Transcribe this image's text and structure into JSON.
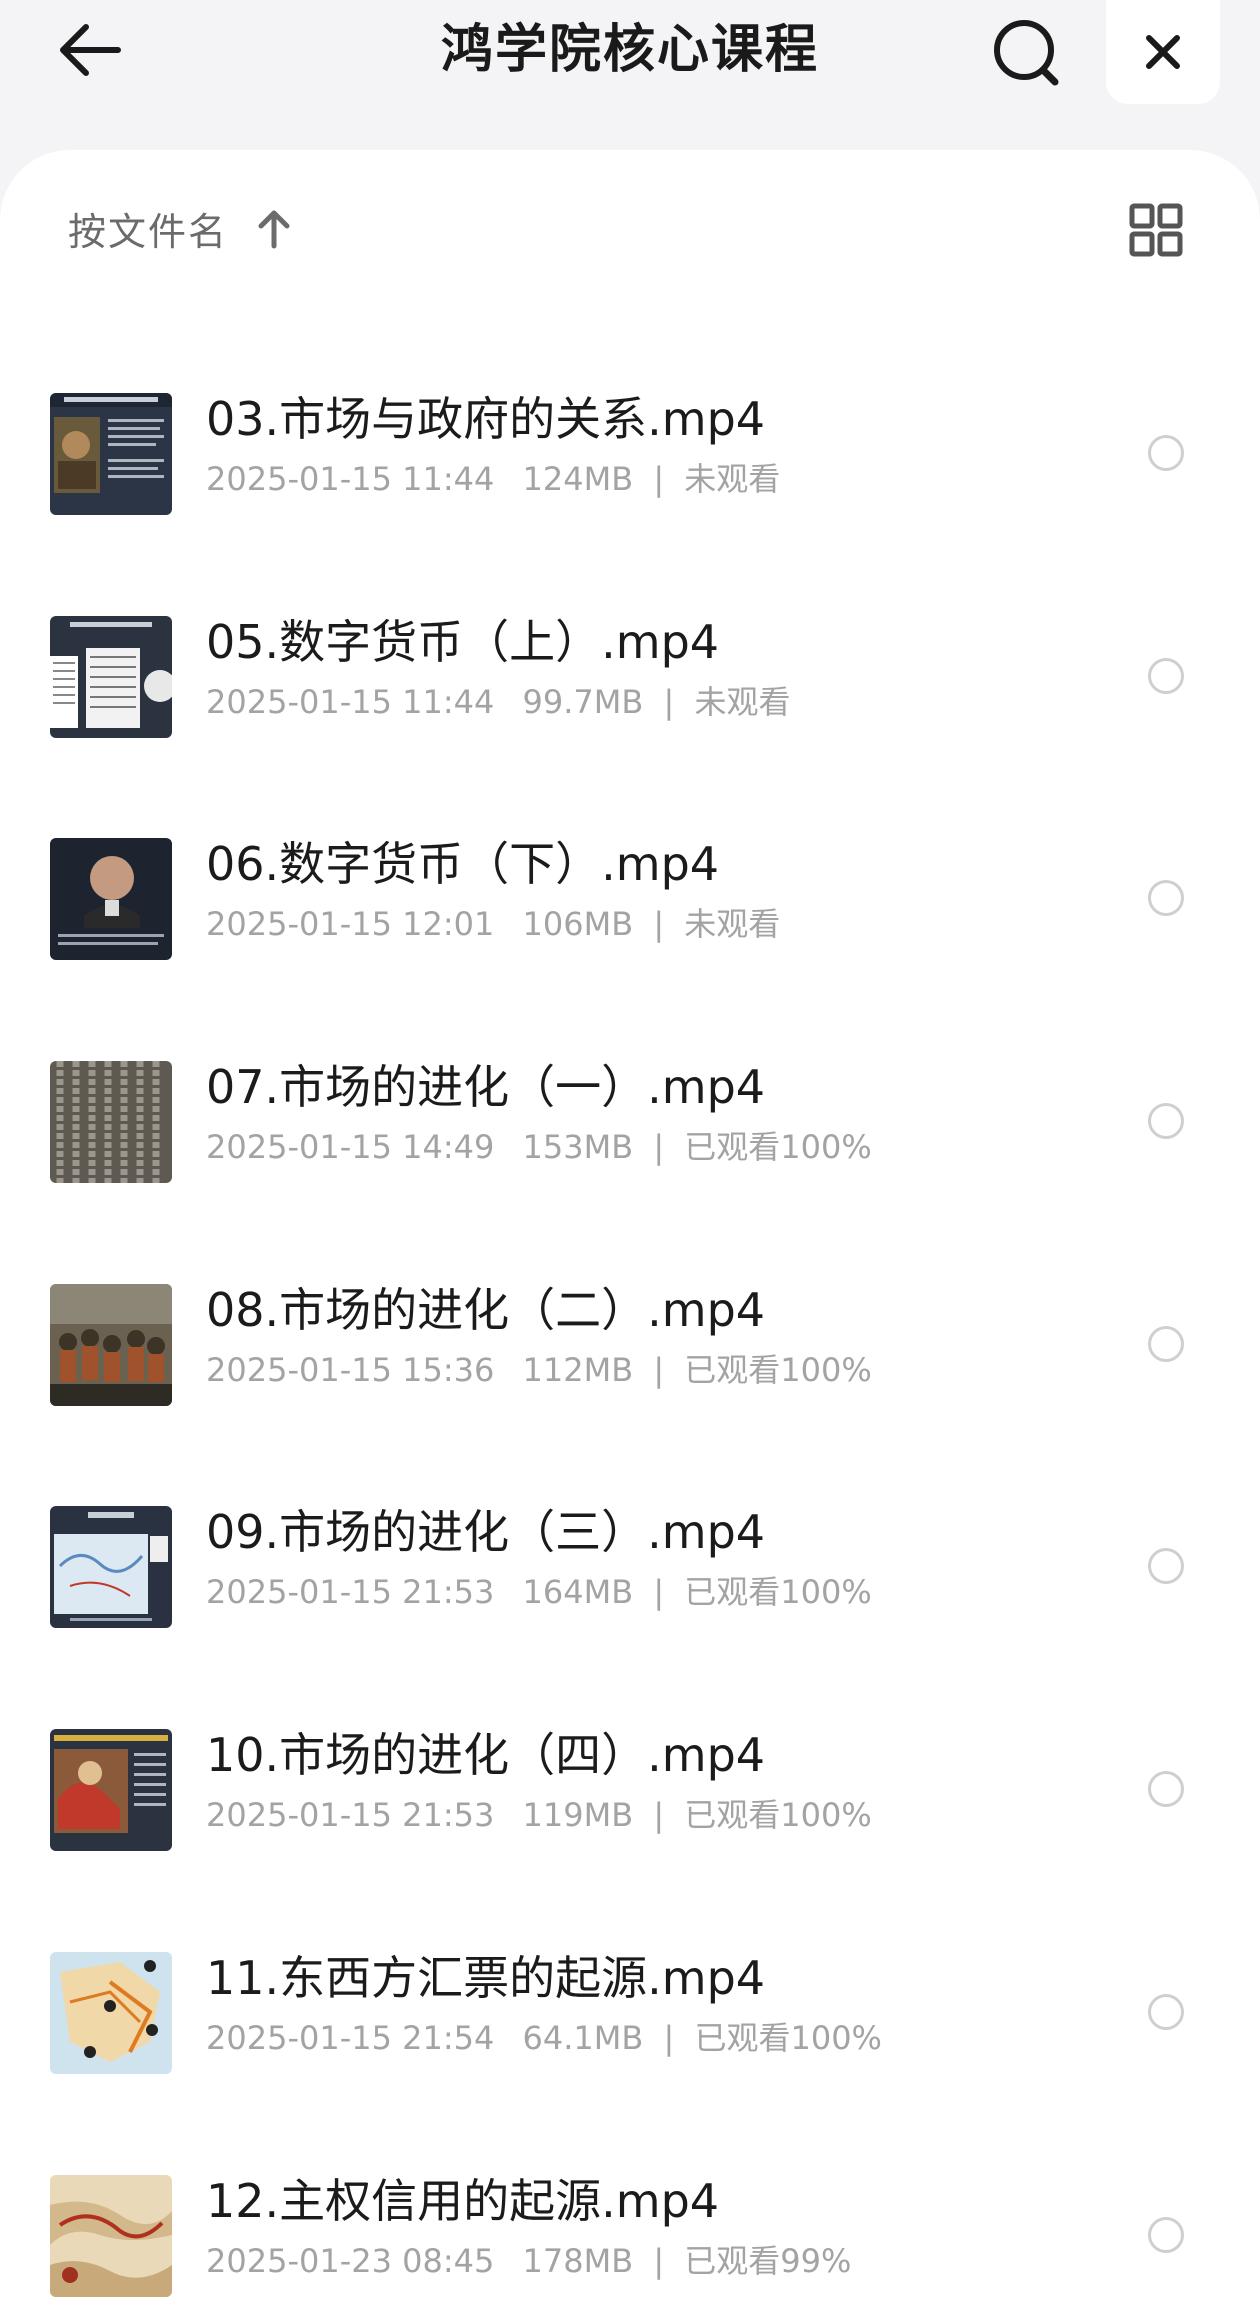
{
  "header": {
    "title": "鸿学院核心课程",
    "back_icon": "arrow-left-icon",
    "search_icon": "search-icon",
    "close_icon": "close-icon"
  },
  "sort": {
    "label": "按文件名",
    "direction_icon": "arrow-up-icon",
    "view_icon": "grid-view-icon"
  },
  "files": [
    {
      "name": "03.市场与政府的关系.mp4",
      "datetime": "2025-01-15 11:44",
      "size": "124MB",
      "status": "未观看"
    },
    {
      "name": "05.数字货币（上）.mp4",
      "datetime": "2025-01-15 11:44",
      "size": "99.7MB",
      "status": "未观看"
    },
    {
      "name": "06.数字货币（下）.mp4",
      "datetime": "2025-01-15 12:01",
      "size": "106MB",
      "status": "未观看"
    },
    {
      "name": "07.市场的进化（一）.mp4",
      "datetime": "2025-01-15 14:49",
      "size": "153MB",
      "status": "已观看100%"
    },
    {
      "name": "08.市场的进化（二）.mp4",
      "datetime": "2025-01-15 15:36",
      "size": "112MB",
      "status": "已观看100%"
    },
    {
      "name": "09.市场的进化（三）.mp4",
      "datetime": "2025-01-15 21:53",
      "size": "164MB",
      "status": "已观看100%"
    },
    {
      "name": "10.市场的进化（四）.mp4",
      "datetime": "2025-01-15 21:53",
      "size": "119MB",
      "status": "已观看100%"
    },
    {
      "name": "11.东西方汇票的起源.mp4",
      "datetime": "2025-01-15 21:54",
      "size": "64.1MB",
      "status": "已观看100%"
    },
    {
      "name": "12.主权信用的起源.mp4",
      "datetime": "2025-01-23 08:45",
      "size": "178MB",
      "status": "已观看99%"
    }
  ],
  "colors": {
    "background": "#f4f4f6",
    "card": "#ffffff",
    "title": "#1a1a1a",
    "meta": "#a3a3a3",
    "radio_border": "#cfcfcf"
  }
}
